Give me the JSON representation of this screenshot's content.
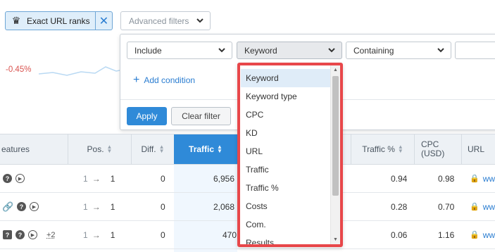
{
  "filter_bar": {
    "url_chip_label": "Exact URL ranks",
    "url_chip_icon": "crown-icon",
    "close_glyph": "✕",
    "advanced_filters_label": "Advanced filters"
  },
  "background_chart": {
    "delta": "-0.45%"
  },
  "panel": {
    "include_value": "Include",
    "field_value": "Keyword",
    "match_value": "Containing",
    "add_condition": "Add condition",
    "apply": "Apply",
    "clear": "Clear filter"
  },
  "table": {
    "headers": {
      "features": "eatures",
      "pos": "Pos.",
      "diff": "Diff.",
      "traffic": "Traffic",
      "traffic_pct": "Traffic %",
      "cpc": "CPC\n(USD)",
      "url": "URL"
    },
    "rows": [
      {
        "pos_from": "1",
        "pos_to": "1",
        "diff": "0",
        "traffic": "6,956",
        "traffic_pct": "0.94",
        "cpc": "0.98",
        "url": "www"
      },
      {
        "pos_from": "1",
        "pos_to": "1",
        "diff": "0",
        "traffic": "2,068",
        "traffic_pct": "0.28",
        "cpc": "0.70",
        "url": "www"
      },
      {
        "pos_from": "1",
        "pos_to": "1",
        "diff": "0",
        "traffic": "470",
        "traffic_pct": "0.06",
        "cpc": "1.16",
        "url": "www"
      }
    ],
    "extra_features": "+2"
  },
  "dropdown": {
    "selected": "Keyword",
    "options": [
      "Keyword",
      "Keyword type",
      "CPC",
      "KD",
      "URL",
      "Traffic",
      "Traffic %",
      "Costs",
      "Com.",
      "Results"
    ],
    "highlight_color": "#e8474a"
  }
}
